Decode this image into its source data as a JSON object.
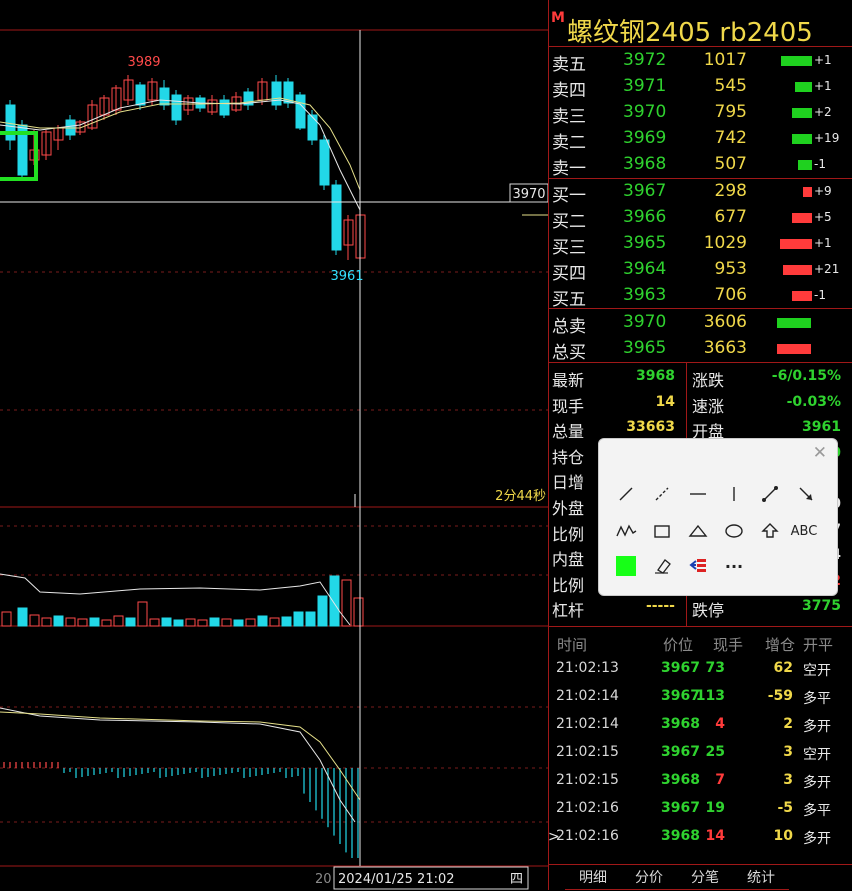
{
  "instrument": {
    "badge": "M",
    "title": "螺纹钢2405  rb2405"
  },
  "chart": {
    "high_label": "3989",
    "low_label": "3961",
    "crosshair_price": "3970",
    "countdown": "2分44秒",
    "date": "2024/01/25 21:02",
    "date_prefix": "20",
    "weekday": "四"
  },
  "order_book": {
    "asks": [
      {
        "label": "卖五",
        "price": "3972",
        "volume": "1017",
        "change": "+1",
        "bar": 0.9
      },
      {
        "label": "卖四",
        "price": "3971",
        "volume": "545",
        "change": "+1",
        "bar": 0.5
      },
      {
        "label": "卖三",
        "price": "3970",
        "volume": "795",
        "change": "+2",
        "bar": 0.6
      },
      {
        "label": "卖二",
        "price": "3969",
        "volume": "742",
        "change": "+19",
        "bar": 0.6
      },
      {
        "label": "卖一",
        "price": "3968",
        "volume": "507",
        "change": "-1",
        "bar": 0.4
      }
    ],
    "bids": [
      {
        "label": "买一",
        "price": "3967",
        "volume": "298",
        "change": "+9",
        "bar": 0.25
      },
      {
        "label": "买二",
        "price": "3966",
        "volume": "677",
        "change": "+5",
        "bar": 0.6
      },
      {
        "label": "买三",
        "price": "3965",
        "volume": "1029",
        "change": "+1",
        "bar": 0.95
      },
      {
        "label": "买四",
        "price": "3964",
        "volume": "953",
        "change": "+21",
        "bar": 0.85
      },
      {
        "label": "买五",
        "price": "3963",
        "volume": "706",
        "change": "-1",
        "bar": 0.6
      }
    ]
  },
  "totals": [
    {
      "label": "总卖",
      "price": "3970",
      "volume": "3606",
      "color": "#1fd11f"
    },
    {
      "label": "总买",
      "price": "3965",
      "volume": "3663",
      "color": "#ff3b3b"
    }
  ],
  "stats_left": [
    {
      "label": "最新",
      "value": "3968",
      "color": "#2fd22f"
    },
    {
      "label": "现手",
      "value": "14",
      "color": "#f0d84a"
    },
    {
      "label": "总量",
      "value": "33663",
      "color": "#f0d84a"
    },
    {
      "label": "持仓",
      "value": "",
      "color": "#f0d84a"
    },
    {
      "label": "日增",
      "value": "",
      "color": "#f0d84a"
    },
    {
      "label": "外盘",
      "value": "",
      "color": "#f0d84a"
    },
    {
      "label": "比例",
      "value": "",
      "color": "#f0d84a"
    },
    {
      "label": "内盘",
      "value": "",
      "color": "#f0d84a"
    },
    {
      "label": "比例",
      "value": "",
      "color": "#f0d84a"
    },
    {
      "label": "杠杆",
      "value": "-----",
      "color": "#f0d84a"
    }
  ],
  "stats_right": [
    {
      "label": "涨跌",
      "value": "-6/0.15%",
      "color": "#2fd22f"
    },
    {
      "label": "速涨",
      "value": "-0.03%",
      "color": "#2fd22f"
    },
    {
      "label": "开盘",
      "value": "3961",
      "color": "#2fd22f"
    },
    {
      "label": "",
      "value": "0",
      "color": "#2fd22f"
    },
    {
      "label": "",
      "value": "",
      "color": "#2fd22f"
    },
    {
      "label": "",
      "value": "0",
      "color": "#e8e8e8"
    },
    {
      "label": "",
      "value": "7",
      "color": "#e8e8e8"
    },
    {
      "label": "",
      "value": "4",
      "color": "#e8e8e8"
    },
    {
      "label": "",
      "value": "2",
      "color": "#ff3b3b"
    },
    {
      "label": "跌停",
      "value": "3775",
      "color": "#2fd22f"
    }
  ],
  "ticks": {
    "headers": [
      "时间",
      "价位",
      "现手",
      "增仓",
      "开平"
    ],
    "rows": [
      {
        "time": "21:02:13",
        "price": "3967",
        "qty": "73",
        "oi": "62",
        "type": "空开",
        "qcolor": "#2fd22f"
      },
      {
        "time": "21:02:14",
        "price": "3967",
        "qty": "113",
        "oi": "-59",
        "type": "多平",
        "qcolor": "#2fd22f"
      },
      {
        "time": "21:02:14",
        "price": "3968",
        "qty": "4",
        "oi": "2",
        "type": "多开",
        "qcolor": "#ff3b3b"
      },
      {
        "time": "21:02:15",
        "price": "3967",
        "qty": "25",
        "oi": "3",
        "type": "空开",
        "qcolor": "#2fd22f"
      },
      {
        "time": "21:02:15",
        "price": "3968",
        "qty": "7",
        "oi": "3",
        "type": "多开",
        "qcolor": "#ff3b3b"
      },
      {
        "time": "21:02:16",
        "price": "3967",
        "qty": "19",
        "oi": "-5",
        "type": "多平",
        "qcolor": "#2fd22f"
      },
      {
        "time": "21:02:16",
        "price": "3968",
        "qty": "14",
        "oi": "10",
        "type": "多开",
        "qcolor": "#ff3b3b"
      }
    ],
    "cursor": ">"
  },
  "tabs": [
    "明细",
    "分价",
    "分笔",
    "统计"
  ],
  "draw_toolbar": {
    "close": "✕",
    "text_tool": "ABC",
    "more": "···",
    "fill_color": "#17ff17",
    "tools": [
      "line-tool",
      "ray-tool",
      "horizontal-line-tool",
      "vertical-line-tool",
      "segment-tool",
      "arrow-line-tool",
      "polyline-tool",
      "rectangle-tool",
      "triangle-tool",
      "ellipse-tool",
      "up-arrow-tool",
      "text-tool",
      "fill-color-tool",
      "eraser-tool",
      "settings-tool",
      "more-tool"
    ]
  }
}
